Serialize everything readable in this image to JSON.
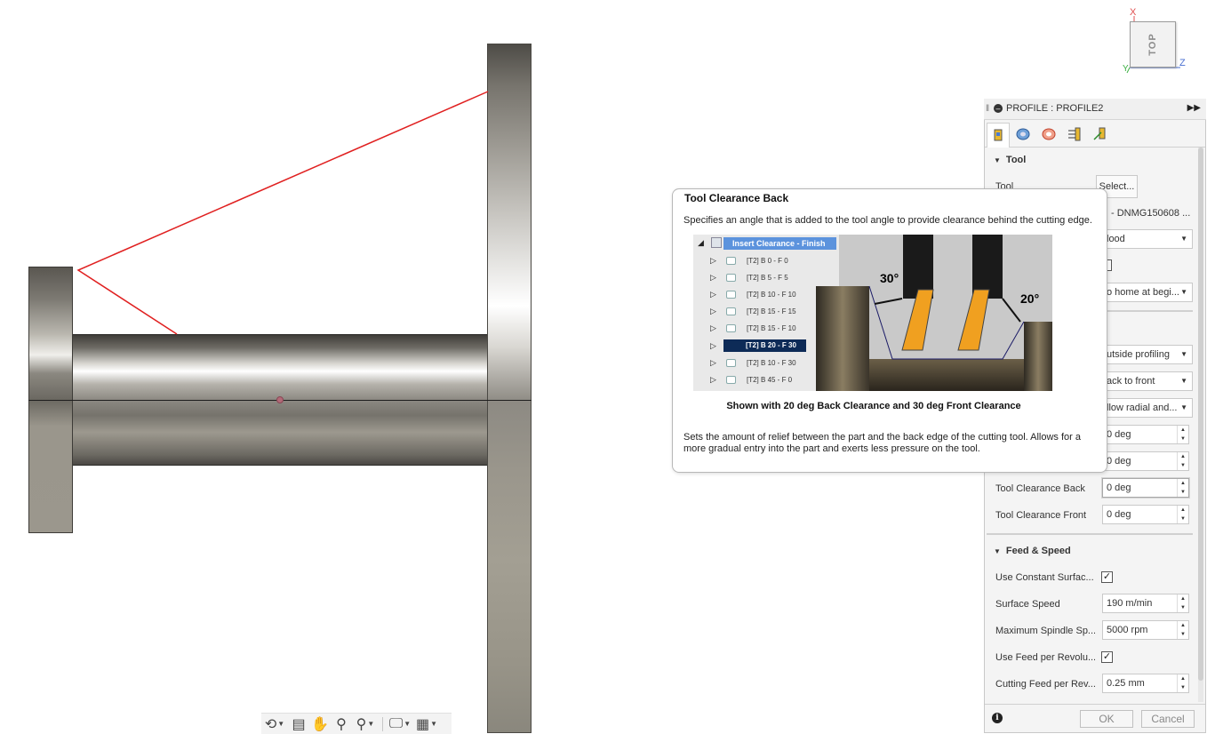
{
  "viewcube": {
    "face_label": "TOP",
    "axis_x": "X",
    "axis_z": "Z",
    "axis_y": "Y"
  },
  "panel": {
    "header_title": "PROFILE : PROFILE2",
    "tabs": [
      "tool-tab",
      "geometry-tab",
      "heights-tab",
      "passes-tab",
      "linking-tab"
    ],
    "tool_section": {
      "title": "Tool",
      "tool_label": "Tool",
      "select_label": "Select...",
      "tool_value": "- DNMG150608 ...",
      "coolant_value": "lood",
      "home_value": "o home at begi..."
    },
    "profile_rows": [
      {
        "value": "utside profiling"
      },
      {
        "value": "ack to front"
      },
      {
        "value": "llow radial and..."
      }
    ],
    "angle_rows": [
      {
        "value": "0 deg"
      },
      {
        "value": "0 deg"
      }
    ],
    "clearance_back": {
      "label": "Tool Clearance Back",
      "value": "0 deg"
    },
    "clearance_front": {
      "label": "Tool Clearance Front",
      "value": "0 deg"
    },
    "feed_speed": {
      "title": "Feed & Speed",
      "use_css_label": "Use Constant Surfac...",
      "use_css_checked": true,
      "surface_speed_label": "Surface Speed",
      "surface_speed_value": "190 m/min",
      "max_spindle_label": "Maximum Spindle Sp...",
      "max_spindle_value": "5000 rpm",
      "use_feed_rev_label": "Use Feed per Revolu...",
      "use_feed_rev_checked": true,
      "cutting_feed_label": "Cutting Feed per Rev...",
      "cutting_feed_value": "0.25 mm"
    },
    "ok_label": "OK",
    "cancel_label": "Cancel"
  },
  "tooltip": {
    "title": "Tool Clearance Back",
    "description": "Specifies an angle that is added to the tool angle to provide clearance behind the cutting edge.",
    "caption": "Shown with 20 deg Back Clearance and 30 deg Front Clearance",
    "body": "Sets the amount of relief between the part and the back edge of the cutting tool. Allows for a more gradual entry into the part and exerts less pressure on the tool.",
    "illustration": {
      "tree_header": "Insert Clearance - Finish",
      "tree_items": [
        "[T2] B 0 - F 0",
        "[T2] B 5 - F 5",
        "[T2] B 10 - F 10",
        "[T2] B 15 - F 15",
        "[T2] B 15 - F 10",
        "[T2] B 20 - F 30",
        "[T2] B 10 - F 30",
        "[T2] B 45 - F 0"
      ],
      "selected_item": "[T2] B 20 - F 30",
      "front_angle_label": "30°",
      "back_angle_label": "20°"
    }
  },
  "colors": {
    "sketch_line": "#e02020",
    "tree_highlight": "#5c93dd",
    "tree_selected": "#0d2b57",
    "insert_orange": "#f0a020"
  }
}
